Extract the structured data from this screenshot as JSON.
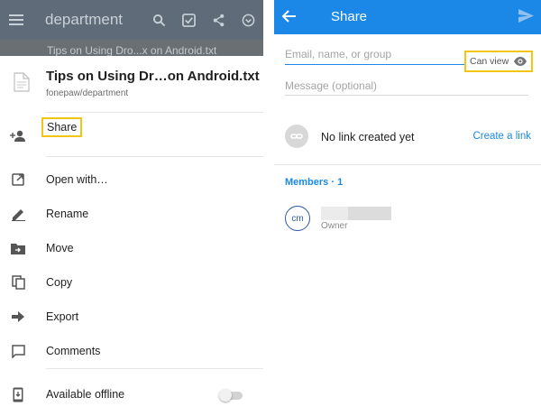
{
  "left": {
    "topbar": {
      "title": "department",
      "menu_icon": "hamburger-menu-icon",
      "actions": [
        "search-icon",
        "select-checkbox-icon",
        "share-icon",
        "more-icon"
      ]
    },
    "dimmed_row_text": "Tips on Using Dro...x on Android.txt",
    "sheet": {
      "file_name": "Tips on Using Dr…on Android.txt",
      "file_path": "fonepaw/department",
      "items": [
        {
          "id": "share",
          "label": "Share",
          "icon": "add-person-icon",
          "highlighted": true
        },
        {
          "id": "open-with",
          "label": "Open with…",
          "icon": "open-external-icon"
        },
        {
          "id": "rename",
          "label": "Rename",
          "icon": "pencil-icon"
        },
        {
          "id": "move",
          "label": "Move",
          "icon": "folder-move-icon"
        },
        {
          "id": "copy",
          "label": "Copy",
          "icon": "copy-icon"
        },
        {
          "id": "export",
          "label": "Export",
          "icon": "export-arrow-icon"
        },
        {
          "id": "comments",
          "label": "Comments",
          "icon": "comment-icon"
        },
        {
          "id": "available-offline",
          "label": "Available offline",
          "icon": "phone-download-icon",
          "toggle_on": false
        }
      ]
    }
  },
  "right": {
    "topbar": {
      "title": "Share",
      "back_icon": "back-arrow-icon",
      "send_icon": "send-icon"
    },
    "email_placeholder": "Email, name, or group",
    "permission": {
      "label": "Can view",
      "icon": "eye-icon"
    },
    "message_placeholder": "Message (optional)",
    "link": {
      "status": "No link created yet",
      "action": "Create a link",
      "icon": "link-icon"
    },
    "members_header": "Members · 1",
    "members": [
      {
        "initials": "cm",
        "role": "Owner"
      }
    ]
  },
  "colors": {
    "accent_blue": "#1b87e6",
    "highlight_yellow": "#f2c515",
    "dim_topbar": "#5f6b78"
  }
}
